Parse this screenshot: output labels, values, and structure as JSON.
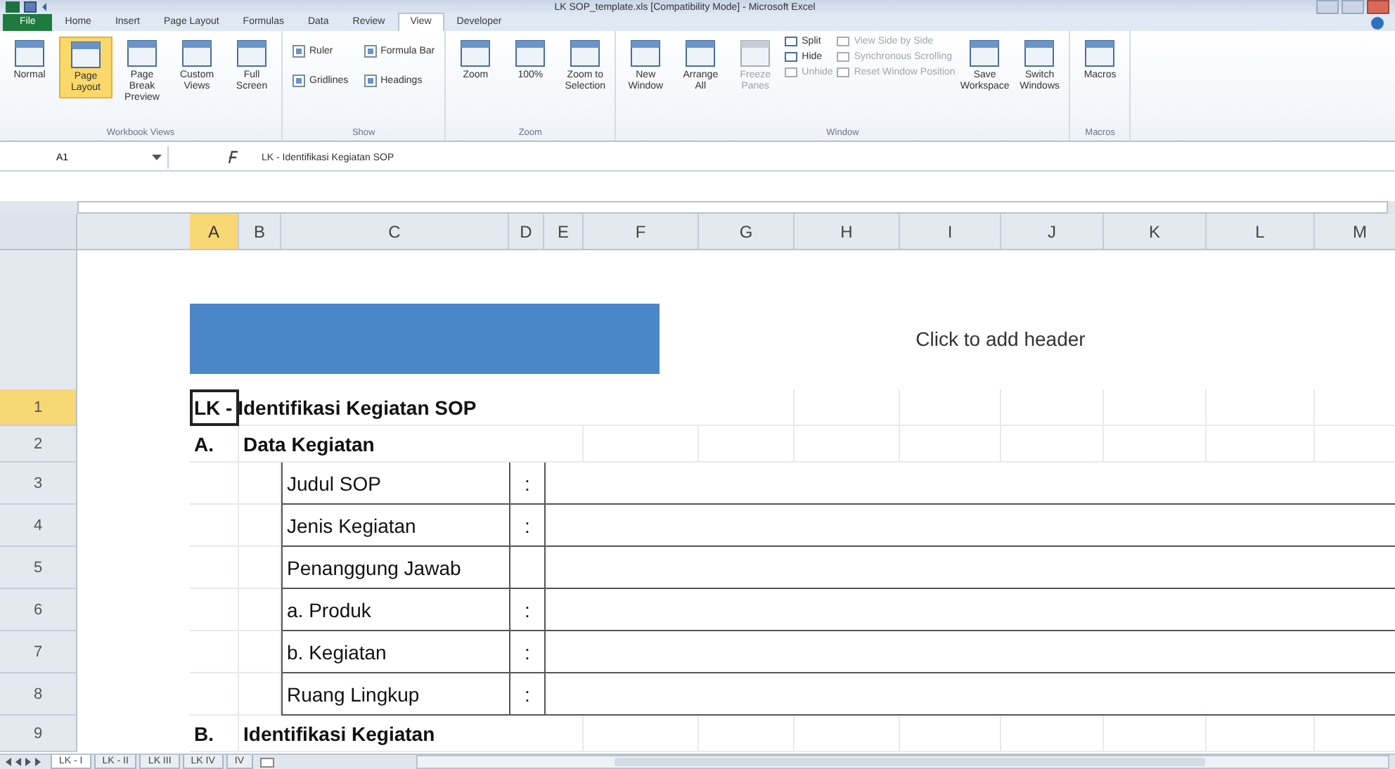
{
  "window": {
    "title": "LK SOP_template.xls [Compatibility Mode] - Microsoft Excel"
  },
  "ribbon_tabs": [
    {
      "label": "File",
      "kind": "file",
      "selected": false
    },
    {
      "label": "Home",
      "kind": "tab",
      "selected": false
    },
    {
      "label": "Insert",
      "kind": "tab",
      "selected": false
    },
    {
      "label": "Page Layout",
      "kind": "tab",
      "selected": false
    },
    {
      "label": "Formulas",
      "kind": "tab",
      "selected": false
    },
    {
      "label": "Data",
      "kind": "tab",
      "selected": false
    },
    {
      "label": "Review",
      "kind": "tab",
      "selected": false
    },
    {
      "label": "View",
      "kind": "tab",
      "selected": true
    },
    {
      "label": "Developer",
      "kind": "tab",
      "selected": false
    }
  ],
  "ribbon_groups": [
    {
      "label": "Workbook Views",
      "columns": [
        [
          {
            "kind": "large",
            "label": "Normal",
            "selected": false,
            "disabled": false
          }
        ],
        [
          {
            "kind": "large",
            "label": "Page Layout",
            "selected": true,
            "disabled": false
          }
        ],
        [
          {
            "kind": "large",
            "label": "Page Break Preview",
            "selected": false,
            "disabled": false
          }
        ],
        [
          {
            "kind": "large",
            "label": "Custom Views",
            "selected": false,
            "disabled": false
          }
        ],
        [
          {
            "kind": "large",
            "label": "Full Screen",
            "selected": false,
            "disabled": false
          }
        ]
      ]
    },
    {
      "label": "Show",
      "columns": [
        [
          {
            "kind": "check",
            "label": "Ruler",
            "checked": true
          },
          {
            "kind": "check",
            "label": "Gridlines",
            "checked": true
          }
        ],
        [
          {
            "kind": "check",
            "label": "Formula Bar",
            "checked": true
          },
          {
            "kind": "check",
            "label": "Headings",
            "checked": true
          }
        ]
      ]
    },
    {
      "label": "Zoom",
      "columns": [
        [
          {
            "kind": "large",
            "label": "Zoom",
            "selected": false,
            "disabled": false
          }
        ],
        [
          {
            "kind": "large",
            "label": "100%",
            "selected": false,
            "disabled": false
          }
        ],
        [
          {
            "kind": "large",
            "label": "Zoom to Selection",
            "selected": false,
            "disabled": false
          }
        ]
      ]
    },
    {
      "label": "Window",
      "columns": [
        [
          {
            "kind": "large",
            "label": "New Window",
            "selected": false,
            "disabled": false
          }
        ],
        [
          {
            "kind": "large",
            "label": "Arrange All",
            "selected": false,
            "disabled": false
          }
        ],
        [
          {
            "kind": "large",
            "label": "Freeze Panes",
            "selected": false,
            "disabled": true
          }
        ],
        [
          {
            "kind": "small",
            "label": "Split",
            "disabled": false
          },
          {
            "kind": "small",
            "label": "Hide",
            "disabled": false
          },
          {
            "kind": "small",
            "label": "Unhide",
            "disabled": true
          }
        ],
        [
          {
            "kind": "small",
            "label": "View Side by Side",
            "disabled": true
          },
          {
            "kind": "small",
            "label": "Synchronous Scrolling",
            "disabled": true
          },
          {
            "kind": "small",
            "label": "Reset Window Position",
            "disabled": true
          }
        ],
        [
          {
            "kind": "large",
            "label": "Save Workspace",
            "selected": false,
            "disabled": false
          }
        ],
        [
          {
            "kind": "large",
            "label": "Switch Windows",
            "selected": false,
            "disabled": false
          }
        ]
      ]
    },
    {
      "label": "Macros",
      "columns": [
        [
          {
            "kind": "large",
            "label": "Macros",
            "selected": false,
            "disabled": false
          }
        ]
      ]
    }
  ],
  "formula_bar": {
    "name_box": "A1",
    "formula": "LK - Identifikasi Kegiatan SOP"
  },
  "columns": [
    {
      "label": "A",
      "selected": true
    },
    {
      "label": "B",
      "selected": false
    },
    {
      "label": "C",
      "selected": false
    },
    {
      "label": "D",
      "selected": false
    },
    {
      "label": "E",
      "selected": false
    },
    {
      "label": "F",
      "selected": false
    },
    {
      "label": "G",
      "selected": false
    },
    {
      "label": "H",
      "selected": false
    },
    {
      "label": "I",
      "selected": false
    },
    {
      "label": "J",
      "selected": false
    },
    {
      "label": "K",
      "selected": false
    },
    {
      "label": "L",
      "selected": false
    },
    {
      "label": "M",
      "selected": false
    }
  ],
  "page_header": {
    "placeholder": "Click to add header"
  },
  "rows": [
    {
      "number": "1",
      "selected": true,
      "kind": "title",
      "text": "LK - Identifikasi Kegiatan SOP"
    },
    {
      "number": "2",
      "selected": false,
      "kind": "section",
      "marker": "A.",
      "text": "Data Kegiatan"
    },
    {
      "number": "3",
      "selected": false,
      "kind": "field",
      "label": "Judul SOP",
      "separator": ":"
    },
    {
      "number": "4",
      "selected": false,
      "kind": "field",
      "label": "Jenis Kegiatan",
      "separator": ":"
    },
    {
      "number": "5",
      "selected": false,
      "kind": "field",
      "label": "Penanggung Jawab"
    },
    {
      "number": "6",
      "selected": false,
      "kind": "field",
      "label": "a. Produk",
      "separator": ":"
    },
    {
      "number": "7",
      "selected": false,
      "kind": "field",
      "label": "b. Kegiatan",
      "separator": ":"
    },
    {
      "number": "8",
      "selected": false,
      "kind": "field",
      "label": "Ruang Lingkup",
      "separator": ":"
    },
    {
      "number": "9",
      "selected": false,
      "kind": "section",
      "marker": "B.",
      "text": "Identifikasi Kegiatan"
    }
  ],
  "sheet_tabs": [
    {
      "label": "LK - I",
      "selected": true
    },
    {
      "label": "LK - II",
      "selected": false
    },
    {
      "label": "LK III",
      "selected": false
    },
    {
      "label": "LK IV",
      "selected": false
    },
    {
      "label": "IV",
      "selected": false
    }
  ]
}
